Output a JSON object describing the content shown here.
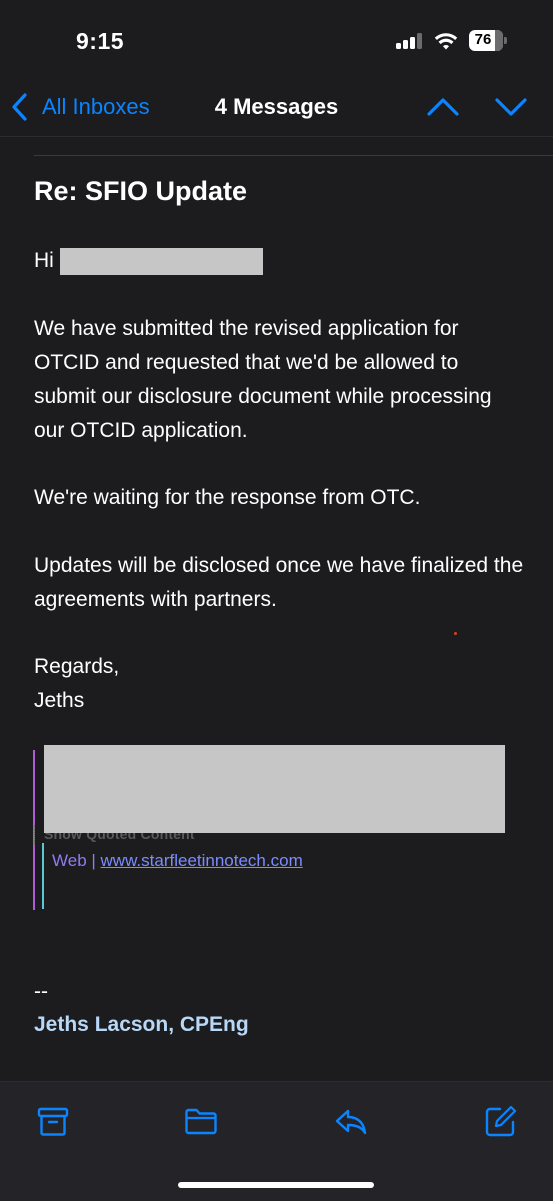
{
  "status": {
    "time": "9:15",
    "battery": "76",
    "signal_icon": "cellular-signal-icon",
    "wifi_icon": "wifi-icon"
  },
  "nav": {
    "back_label": "All Inboxes",
    "title": "4 Messages",
    "up_icon": "chevron-up-icon",
    "down_icon": "chevron-down-icon"
  },
  "email": {
    "subject": "Re: SFIO Update",
    "greeting": "Hi",
    "paragraphs": [
      "We have submitted the revised application for OTCID and requested that we'd be allowed to submit our disclosure document while processing our OTCID application.",
      "We're waiting for the response from OTC.",
      "Updates will be disclosed once we have finalized the agreements with partners."
    ],
    "closing": "Regards,",
    "sender_short": "Jeths",
    "show_quoted": "Show Quoted Content",
    "web_label": "Web |",
    "web_link": "www.starfleetinnotech.com",
    "sig_dashes": "--",
    "sig_full": "Jeths Lacson, CPEng"
  },
  "toolbar": {
    "items": [
      "archive-icon",
      "folder-icon",
      "reply-icon",
      "compose-icon"
    ]
  },
  "colors": {
    "accent": "#0a84ff",
    "background": "#1c1c1e",
    "redaction": "#c6c6c6"
  }
}
